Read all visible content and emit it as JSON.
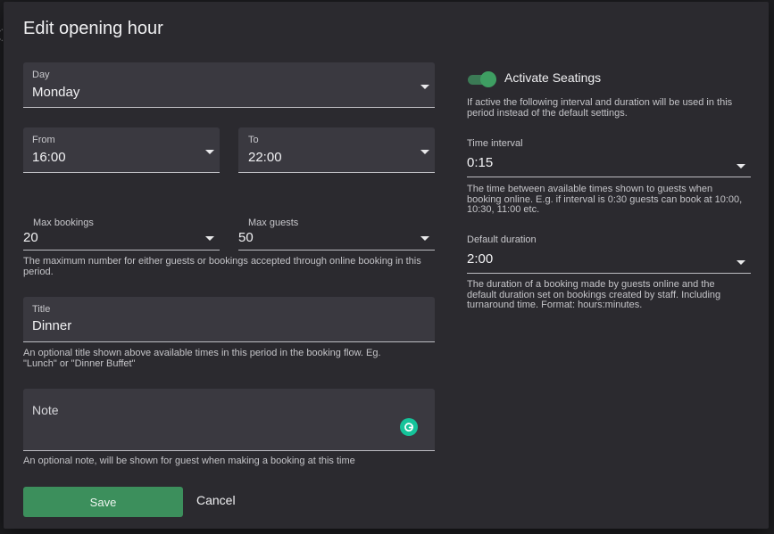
{
  "dialog": {
    "title": "Edit opening hour",
    "day": {
      "label": "Day",
      "value": "Monday"
    },
    "from": {
      "label": "From",
      "value": "16:00"
    },
    "to": {
      "label": "To",
      "value": "22:00"
    },
    "max_bookings": {
      "label": "Max bookings",
      "value": "20"
    },
    "max_guests": {
      "label": "Max guests",
      "value": "50"
    },
    "max_help": "The maximum number for either guests or bookings accepted through online booking in this period.",
    "title_field": {
      "label": "Title",
      "value": "Dinner"
    },
    "title_help": "An optional title shown above available times in this period in the booking flow. Eg. \"Lunch\" or \"Dinner Buffet\"",
    "note_field": {
      "placeholder": "Note"
    },
    "note_help": "An optional note, will be shown for guest when making a booking at this time",
    "seatings": {
      "toggle_label": "Activate Seatings",
      "toggle_on": true,
      "help": "If active the following interval and duration will be used in this period instead of the default settings."
    },
    "time_interval": {
      "label": "Time interval",
      "value": "0:15",
      "help": "The time between available times shown to guests when booking online. E.g. if interval is 0:30 guests can book at 10:00, 10:30, 11:00 etc."
    },
    "default_duration": {
      "label": "Default duration",
      "value": "2:00",
      "help": "The duration of a booking made by guests online and the default duration set on bookings created by staff. Including turnaround time. Format: hours:minutes."
    },
    "save_label": "Save",
    "cancel_label": "Cancel"
  },
  "colors": {
    "accent": "#3c8f5c",
    "dialog_bg": "#2b2a2f",
    "field_bg": "#3a3940",
    "grammarly": "#15c39a"
  },
  "icons": [
    "dropdown-caret-icon",
    "grammarly-icon",
    "toggle-switch"
  ]
}
